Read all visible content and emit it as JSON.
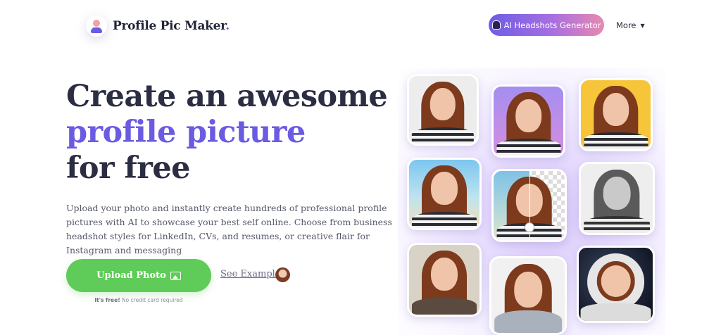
{
  "header": {
    "brand_name": "Profile Pic Maker",
    "brand_dot": ".",
    "ai_button_label": "AI Headshots Generator",
    "more_label": "More",
    "more_caret": "▼"
  },
  "hero": {
    "headline_line1": "Create an awesome",
    "headline_accent": "profile picture",
    "headline_line3": "for free",
    "description": "Upload your photo and instantly create hundreds of professional profile pictures with AI to showcase your best self online. Choose from business headshot styles for LinkedIn, CVs, and resumes, or creative flair for Instagram and messaging",
    "upload_label": "Upload Photo",
    "free_strong": "It's free!",
    "free_rest": "No credit card required",
    "see_example_label": "See Example"
  },
  "icons": {
    "logo": "user-avatar-icon",
    "ai_button": "robot-icon",
    "upload": "image-icon",
    "more": "caret-down-icon"
  },
  "colors": {
    "accent": "#6a5be2",
    "headline": "#2b2d42",
    "upload_button": "#5fcb58",
    "ai_gradient_start": "#6e5ce6",
    "ai_gradient_end": "#e88ab0"
  },
  "gallery": {
    "tiles": [
      "grey-background",
      "purple-gradient-background",
      "yellow-background",
      "beach-background",
      "background-removal-compare",
      "black-and-white",
      "realistic-portrait",
      "business-suit",
      "astronaut"
    ]
  }
}
